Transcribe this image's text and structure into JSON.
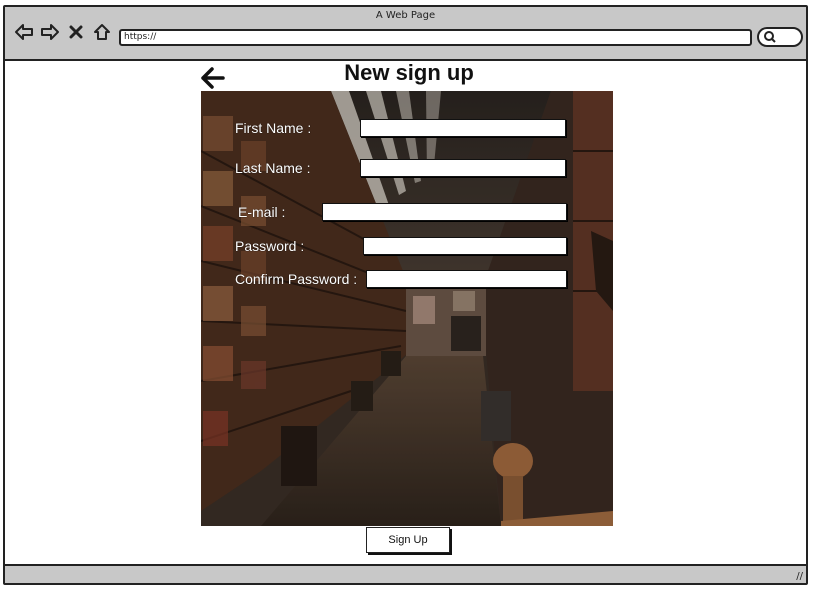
{
  "window": {
    "title": "A Web Page"
  },
  "browser": {
    "address": "https://"
  },
  "form": {
    "title": "New sign up",
    "fields": [
      {
        "label": "First Name :",
        "value": ""
      },
      {
        "label": "Last Name :",
        "value": ""
      },
      {
        "label": "E-mail :",
        "value": ""
      },
      {
        "label": "Password :",
        "value": ""
      },
      {
        "label": "Confirm Password :",
        "value": ""
      }
    ],
    "submit_label": "Sign Up"
  },
  "icons": {
    "back": "back-arrow-icon",
    "forward": "forward-arrow-icon",
    "close": "close-icon",
    "home": "home-icon",
    "search": "search-icon",
    "resize": "resize-grip-icon"
  }
}
